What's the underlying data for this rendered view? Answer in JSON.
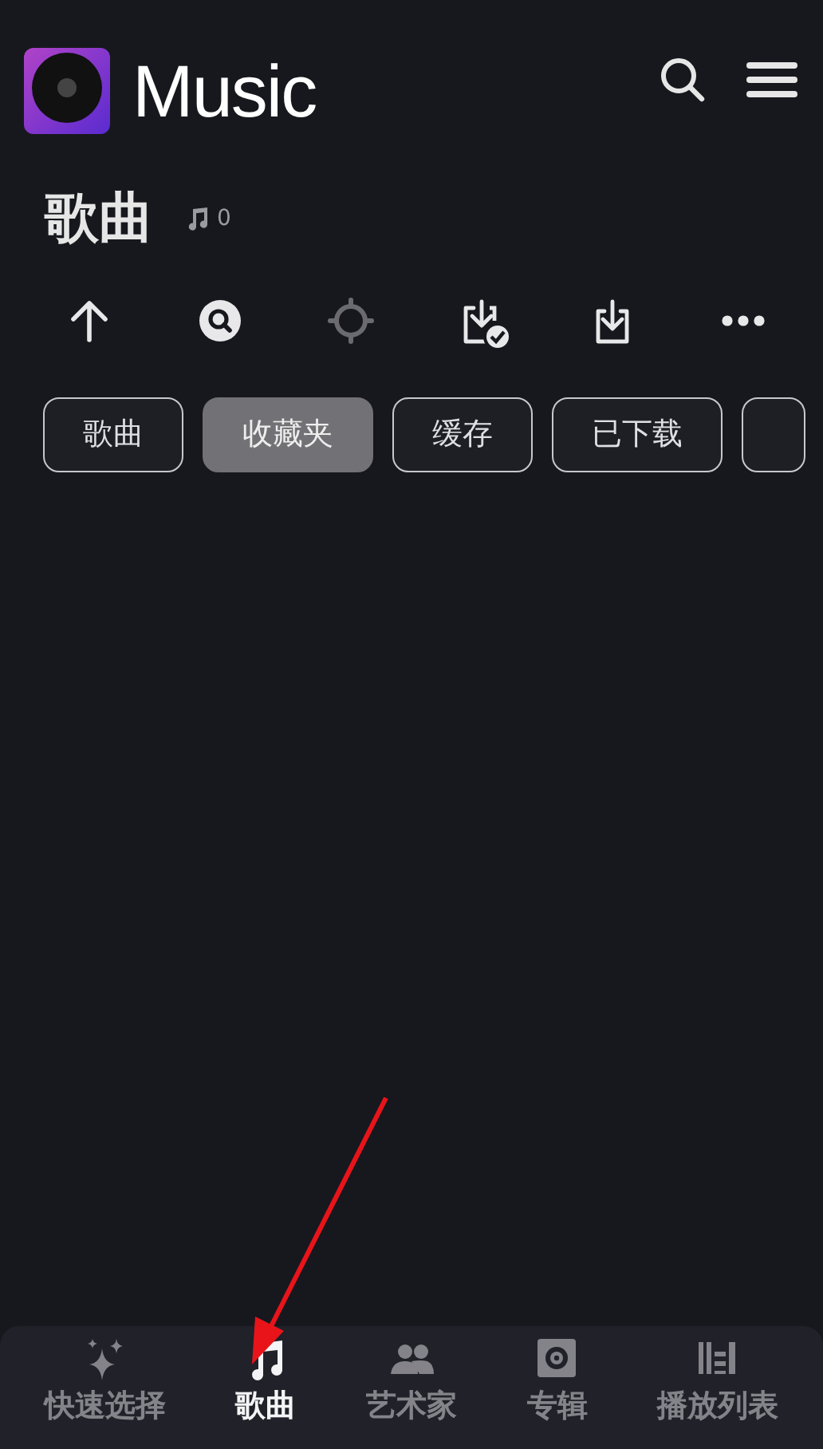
{
  "app_bar": {
    "logo_text": "Music"
  },
  "header": {
    "title": "歌曲",
    "count": "0"
  },
  "toolbar": [
    {
      "kind": "up",
      "disabled": false
    },
    {
      "kind": "search",
      "disabled": false
    },
    {
      "kind": "locate",
      "disabled": true
    },
    {
      "kind": "downloaded",
      "disabled": false
    },
    {
      "kind": "download",
      "disabled": false
    },
    {
      "kind": "more",
      "disabled": false
    }
  ],
  "filters": [
    {
      "label": "歌曲",
      "selected": false
    },
    {
      "label": "收藏夹",
      "selected": true
    },
    {
      "label": "缓存",
      "selected": false
    },
    {
      "label": "已下载",
      "selected": false
    },
    {
      "selected": false
    }
  ],
  "bottom_nav": [
    {
      "kind": "sparkle",
      "label": "快速选择",
      "selected": false
    },
    {
      "kind": "note",
      "label": "歌曲",
      "selected": true
    },
    {
      "kind": "people",
      "label": "艺术家",
      "selected": false
    },
    {
      "kind": "album",
      "label": "专辑",
      "selected": false
    },
    {
      "kind": "library",
      "label": "播放列表",
      "selected": false
    }
  ]
}
